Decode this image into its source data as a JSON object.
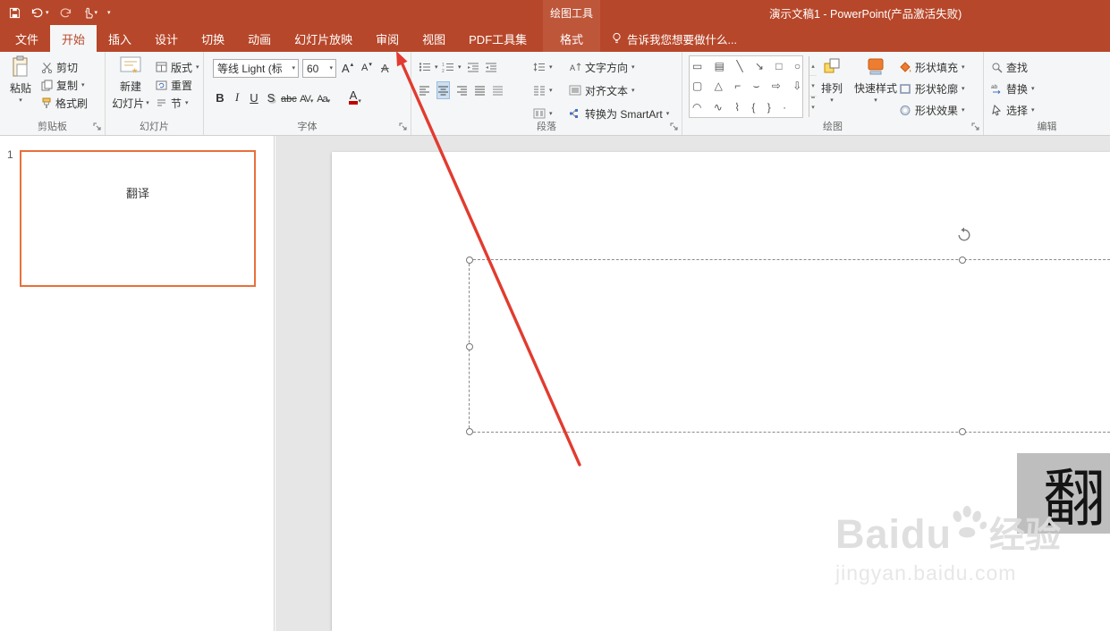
{
  "titlebar": {
    "title": "演示文稿1 - PowerPoint(产品激活失败)",
    "contextual_header": "绘图工具"
  },
  "tabs": {
    "file": "文件",
    "home": "开始",
    "insert": "插入",
    "design": "设计",
    "transitions": "切换",
    "animations": "动画",
    "slideshow": "幻灯片放映",
    "review": "审阅",
    "view": "视图",
    "pdf": "PDF工具集",
    "format": "格式",
    "tell_me": "告诉我您想要做什么..."
  },
  "ribbon": {
    "clipboard": {
      "group": "剪贴板",
      "paste": "粘贴",
      "cut": "剪切",
      "copy": "复制",
      "format_painter": "格式刷"
    },
    "slides": {
      "group": "幻灯片",
      "new_slide_line1": "新建",
      "new_slide_line2": "幻灯片",
      "layout": "版式",
      "reset": "重置",
      "section": "节"
    },
    "font": {
      "group": "字体",
      "name": "等线 Light (标",
      "size": "60",
      "bold": "B",
      "italic": "I",
      "underline": "U",
      "shadow": "S",
      "strikethrough": "abc",
      "char_spacing": "AV",
      "change_case": "Aa",
      "font_color": "A"
    },
    "paragraph": {
      "group": "段落",
      "text_direction": "文字方向",
      "align_text": "对齐文本",
      "smartart": "转换为 SmartArt"
    },
    "drawing": {
      "group": "绘图",
      "arrange": "排列",
      "quick_styles": "快速样式",
      "shape_fill": "形状填充",
      "shape_outline": "形状轮廓",
      "shape_effects": "形状效果",
      "gallery_rows": [
        "▭ ▤ ╲ ↘ □ ○",
        "▢ △ ⌐ ⌣ ⇨ ⇩",
        "◠ ∿ ⌇ { } ·"
      ]
    },
    "editing": {
      "group": "编辑",
      "find": "查找",
      "replace": "替换",
      "select": "选择"
    }
  },
  "slides_panel": {
    "slide_number": "1",
    "thumbnail_text": "翻译"
  },
  "slide": {
    "selected_text": "翻译"
  },
  "watermark": {
    "brand": "Baidu",
    "brand_suffix": "经验",
    "url": "jingyan.baidu.com"
  },
  "icons": {
    "caret": "▾",
    "scroll_up": "▴",
    "scroll_down": "▾",
    "letter_a": "A"
  },
  "colors": {
    "accent": "#B7472A",
    "contextual_band": "#BE563A",
    "selection_highlight": "#BEBEBE",
    "thumbnail_border": "#E8703A",
    "annotation_arrow": "#E23B2F"
  }
}
